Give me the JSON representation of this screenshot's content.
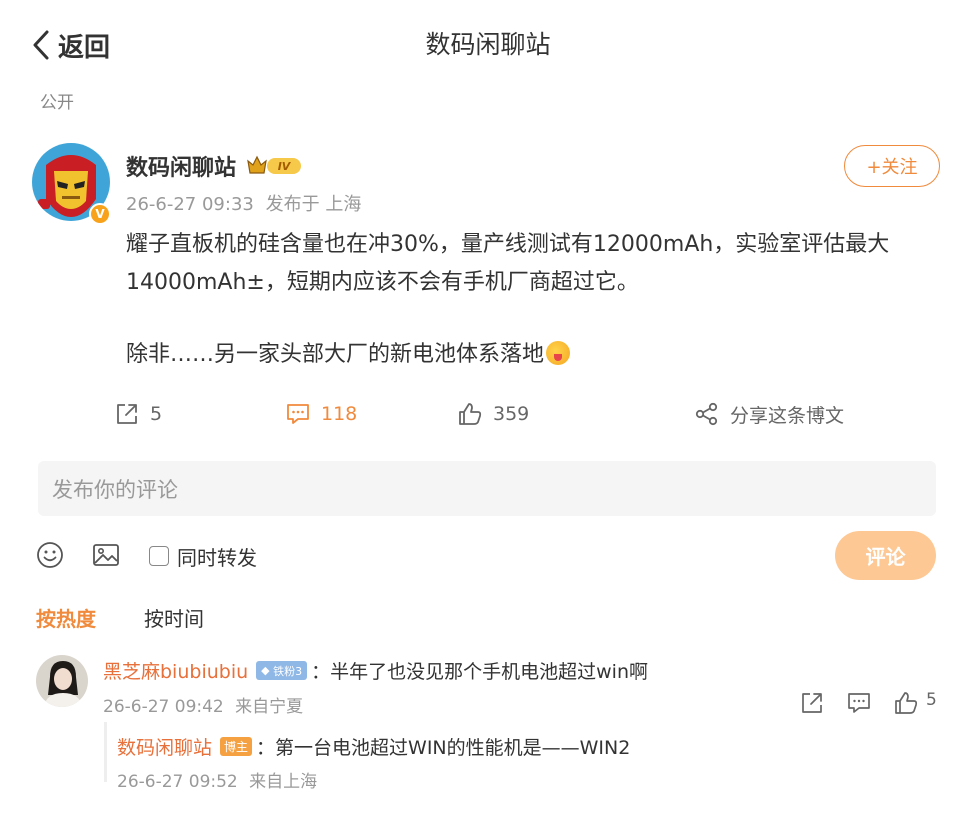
{
  "header": {
    "back_label": "返回",
    "title": "数码闲聊站",
    "visibility": "公开"
  },
  "post": {
    "author": "数码闲聊站",
    "level_badge": "IV",
    "verify_mark": "V",
    "date": "26-6-27 09:33",
    "source": "发布于 上海",
    "follow_label": "+关注",
    "line1": "耀子直板机的硅含量也在冲30%，量产线测试有12000mAh，实验室评估最大",
    "line2": "14000mAh±，短期内应该不会有手机厂商超过它。",
    "line3": "除非……另一家头部大厂的新电池体系落地",
    "reposts": "5",
    "comments": "118",
    "likes": "359",
    "share_label": "分享这条博文"
  },
  "composer": {
    "placeholder": "发布你的评论",
    "repost_label": "同时转发",
    "submit_label": "评论"
  },
  "sort_tabs": {
    "hot": "按热度",
    "time": "按时间"
  },
  "comments": [
    {
      "user": "黑芝麻biubiubiu",
      "badge": "铁粉3",
      "text": "：半年了也没见那个手机电池超过win啊",
      "date": "26-6-27 09:42",
      "source": "来自宁夏",
      "likes": "5"
    }
  ],
  "reply": {
    "user": "数码闲聊站",
    "badge": "博主",
    "text": "：第一台电池超过WIN的性能机是——WIN2",
    "date": "26-6-27 09:52",
    "source": "来自上海"
  },
  "colors": {
    "accent": "#f08a3c",
    "submit_disabled": "#fdc894",
    "name_link": "#e8703a"
  },
  "icons": [
    "chevron-left-icon",
    "repost-icon",
    "comment-icon",
    "like-icon",
    "share-icon",
    "emoji-icon",
    "image-icon"
  ]
}
